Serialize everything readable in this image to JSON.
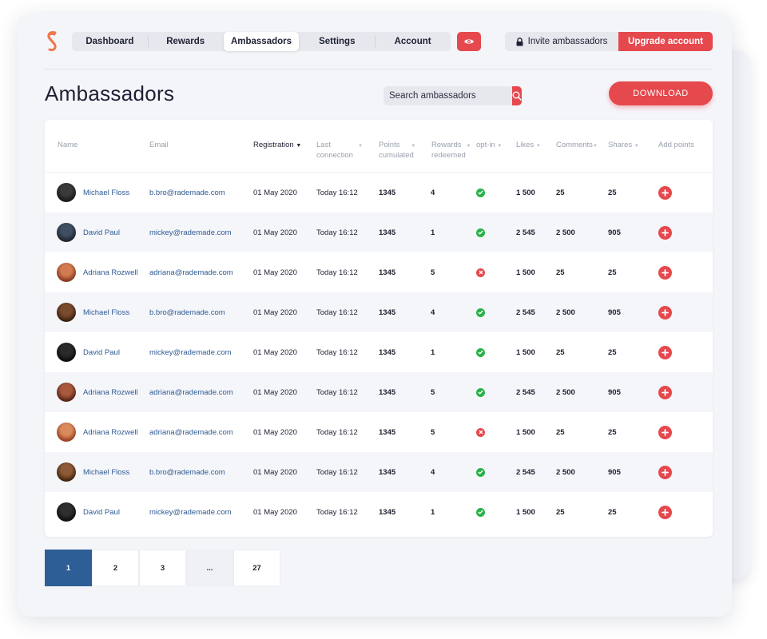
{
  "nav": {
    "items": [
      "Dashboard",
      "Rewards",
      "Ambassadors",
      "Settings",
      "Account"
    ],
    "active_index": 2
  },
  "eye_icon": "eye-icon",
  "header_actions": {
    "invite_label": "Invite ambassadors",
    "invite_icon": "lock-icon",
    "upgrade_label": "Upgrade account"
  },
  "page": {
    "title": "Ambassadors"
  },
  "search": {
    "placeholder": "Search ambassadors",
    "icon": "search-icon"
  },
  "download_label": "DOWNLOAD",
  "table": {
    "headers": {
      "name": "Name",
      "email": "Email",
      "registration": "Registration",
      "last_connection": [
        "Last",
        "connection"
      ],
      "points": [
        "Points",
        "cumulated"
      ],
      "rewards": [
        "Rewards",
        "redeemed"
      ],
      "optin": "opt-in",
      "likes": "Likes",
      "comments": "Comments",
      "shares": "Shares",
      "add_points": "Add points"
    },
    "rows": [
      {
        "name": "Michael Floss",
        "email": "b.bro@rademade.com",
        "registration": "01 May 2020",
        "last_connection": "Today 16:12",
        "points": "1345",
        "rewards": "4",
        "optin": true,
        "likes": "1 500",
        "comments": "25",
        "shares": "25"
      },
      {
        "name": "David Paul",
        "email": "mickey@rademade.com",
        "registration": "01 May 2020",
        "last_connection": "Today 16:12",
        "points": "1345",
        "rewards": "1",
        "optin": true,
        "likes": "2 545",
        "comments": "2 500",
        "shares": "905"
      },
      {
        "name": "Adriana Rozwell",
        "email": "adriana@rademade.com",
        "registration": "01 May 2020",
        "last_connection": "Today 16:12",
        "points": "1345",
        "rewards": "5",
        "optin": false,
        "likes": "1 500",
        "comments": "25",
        "shares": "25"
      },
      {
        "name": "Michael Floss",
        "email": "b.bro@rademade.com",
        "registration": "01 May 2020",
        "last_connection": "Today 16:12",
        "points": "1345",
        "rewards": "4",
        "optin": true,
        "likes": "2 545",
        "comments": "2 500",
        "shares": "905"
      },
      {
        "name": "David Paul",
        "email": "mickey@rademade.com",
        "registration": "01 May 2020",
        "last_connection": "Today 16:12",
        "points": "1345",
        "rewards": "1",
        "optin": true,
        "likes": "1 500",
        "comments": "25",
        "shares": "25"
      },
      {
        "name": "Adriana Rozwell",
        "email": "adriana@rademade.com",
        "registration": "01 May 2020",
        "last_connection": "Today 16:12",
        "points": "1345",
        "rewards": "5",
        "optin": true,
        "likes": "2 545",
        "comments": "2 500",
        "shares": "905"
      },
      {
        "name": "Adriana Rozwell",
        "email": "adriana@rademade.com",
        "registration": "01 May 2020",
        "last_connection": "Today 16:12",
        "points": "1345",
        "rewards": "5",
        "optin": false,
        "likes": "1 500",
        "comments": "25",
        "shares": "25"
      },
      {
        "name": "Michael Floss",
        "email": "b.bro@rademade.com",
        "registration": "01 May 2020",
        "last_connection": "Today 16:12",
        "points": "1345",
        "rewards": "4",
        "optin": true,
        "likes": "2 545",
        "comments": "2 500",
        "shares": "905"
      },
      {
        "name": "David Paul",
        "email": "mickey@rademade.com",
        "registration": "01 May 2020",
        "last_connection": "Today 16:12",
        "points": "1345",
        "rewards": "1",
        "optin": true,
        "likes": "1 500",
        "comments": "25",
        "shares": "25"
      }
    ]
  },
  "pagination": {
    "pages": [
      "1",
      "2",
      "3",
      "...",
      "27"
    ],
    "active_index": 0
  },
  "colors": {
    "accent": "#e5484d",
    "link": "#2e5a93",
    "active_page": "#2d5f96",
    "success": "#28b24b",
    "error": "#e5484d"
  }
}
